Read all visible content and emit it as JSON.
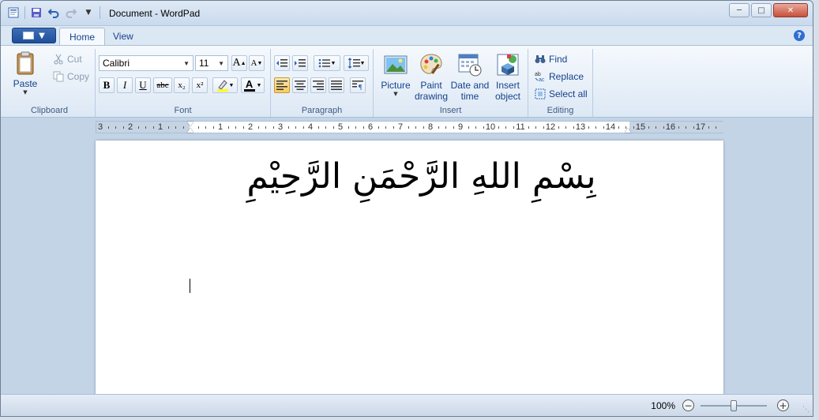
{
  "window": {
    "title": "Document - WordPad"
  },
  "tabs": [
    {
      "label": "Home",
      "active": true
    },
    {
      "label": "View",
      "active": false
    }
  ],
  "clipboard": {
    "group_label": "Clipboard",
    "paste": "Paste",
    "cut": "Cut",
    "copy": "Copy"
  },
  "font": {
    "group_label": "Font",
    "family": "Calibri",
    "size": "11",
    "bold": "B",
    "italic": "I",
    "underline": "U",
    "strike": "abc",
    "subscript": "x₂",
    "superscript": "x²",
    "grow": "A",
    "shrink": "A",
    "font_color": "A"
  },
  "paragraph": {
    "group_label": "Paragraph"
  },
  "insert": {
    "group_label": "Insert",
    "picture": "Picture",
    "paint_line1": "Paint",
    "paint_line2": "drawing",
    "datetime_line1": "Date and",
    "datetime_line2": "time",
    "object_line1": "Insert",
    "object_line2": "object"
  },
  "editing": {
    "group_label": "Editing",
    "find": "Find",
    "replace": "Replace",
    "select_all": "Select all"
  },
  "document": {
    "text": "بِسْمِ اللهِ الرَّحْمَنِ الرَّحِيْمِ"
  },
  "ruler": {
    "labels": [
      "3",
      "2",
      "1",
      "1",
      "2",
      "3",
      "4",
      "5",
      "6",
      "7",
      "8",
      "9",
      "10",
      "11",
      "12",
      "13",
      "14",
      "15",
      "16",
      "17"
    ]
  },
  "status": {
    "zoom": "100%",
    "zoom_out": "−",
    "zoom_in": "+",
    "zoom_fraction": 0.5
  },
  "colors": {
    "accent": "#15428b",
    "font_color_bar": "#000000",
    "highlight_bar": "#ffff00"
  }
}
